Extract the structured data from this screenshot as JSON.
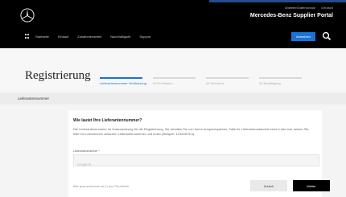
{
  "header": {
    "legal_links": [
      "Anbieter/Datenschutz",
      "Deutsch"
    ],
    "portal_title": "Mercedes-Benz Supplier Portal",
    "nav_items": [
      "Startseite",
      "Einkauf",
      "Zusammenarbeit",
      "Nachhaltigkeit",
      "Support"
    ],
    "login_label": "Anmelden"
  },
  "page": {
    "title": "Registrierung",
    "steps": [
      {
        "label": "Lieferantennummer Verifizierung",
        "active": true
      },
      {
        "label": "03 Profildaten",
        "active": false
      },
      {
        "label": "03 Standorte",
        "active": false
      },
      {
        "label": "04 Bestätigung",
        "active": false
      }
    ]
  },
  "section": {
    "label": "Lieferantennummer"
  },
  "form": {
    "question": "Wie lautet Ihre Lieferantennummer?",
    "explanation": "Die Lieferantennummer ist Voraussetzung für die Registrierung. Sie erhalten Sie von Ihrem Ansprechpartner. Falls Ihr Lieferantenstandort einen Index hat, setzen Sie bitte ein Leerzeichen zwischen Lieferantennummer und Index (Beispiel: 12345678 A).",
    "field_label": "Lieferantennummer *",
    "field_placeholder": "12345678",
    "field_value": "",
    "required_note": "Bitte gekennzeichnet mit (*) sind Pflichtfelder",
    "back_label": "Zurück",
    "next_label": "Weiter"
  },
  "colors": {
    "header_bg": "#000000",
    "accent": "#1a73d9",
    "primary_button": "#000000"
  }
}
